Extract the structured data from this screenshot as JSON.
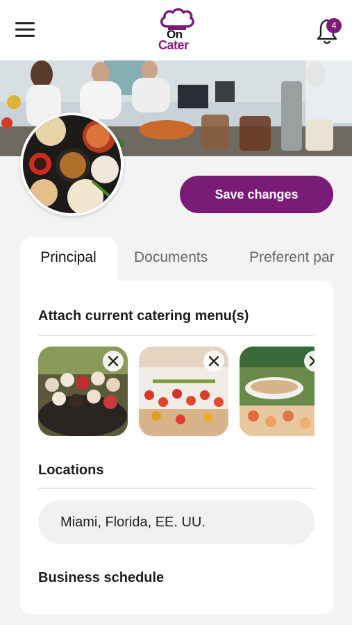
{
  "header": {
    "logo_on": "On",
    "logo_cater": "Cater",
    "notification_count": "4",
    "icons": {
      "menu": "hamburger-menu-icon",
      "bell": "bell-icon",
      "logo_hat": "chef-hat-icon"
    }
  },
  "profile": {
    "save_label": "Save changes"
  },
  "tabs": [
    {
      "label": "Principal",
      "active": true
    },
    {
      "label": "Documents",
      "active": false
    },
    {
      "label": "Preferent par",
      "active": false
    }
  ],
  "sections": {
    "menus_title": "Attach current catering menu(s)",
    "locations_title": "Locations",
    "location_value": "Miami, Florida, EE. UU.",
    "schedule_title": "Business schedule"
  },
  "colors": {
    "accent": "#7b1b78",
    "background": "#f3f3f3",
    "card": "#ffffff"
  }
}
